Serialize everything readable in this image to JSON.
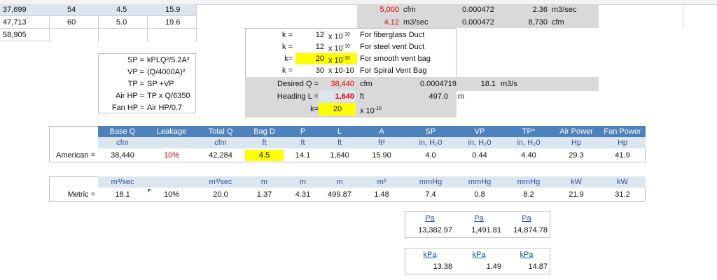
{
  "sheet": {
    "top_left_rows": [
      {
        "a": "37,699",
        "b": "54",
        "c": "4.5",
        "d": "15.9"
      },
      {
        "a": "47,713",
        "b": "60",
        "c": "5.0",
        "d": "19.6"
      },
      {
        "a": "58,905",
        "b": "",
        "c": "",
        "d": ""
      }
    ],
    "conversions": [
      {
        "v1": "5,000",
        "u1": "cfm",
        "f": "0.000472",
        "v2": "2.36",
        "u2": "m3/sec"
      },
      {
        "v1": "4.12",
        "u1": "m3/sec",
        "f": "0.000472",
        "v2": "8,730",
        "u2": "cfm"
      }
    ],
    "k_rows": [
      {
        "label": "k =",
        "value": "12",
        "mult": "x 10",
        "exp": "-10",
        "desc": "For fiberglass Duct"
      },
      {
        "label": "k =",
        "value": "12",
        "mult": "x 10",
        "exp": "-10",
        "desc": "For steel vent Duct"
      },
      {
        "label": "k=",
        "value": "20",
        "mult": "x 10",
        "exp": "-10",
        "desc": "For smooth vent bag"
      },
      {
        "label": "k =",
        "value": "30",
        "mult": "x 10-10",
        "exp": "",
        "desc": "For Spiral Vent Bag"
      }
    ],
    "desired_q": {
      "label": "Desired Q =",
      "value": "38,440",
      "unit": "cfm",
      "factor": "0.0004719",
      "metric": "18.1",
      "metric_unit": "m3/s"
    },
    "heading": {
      "label": "Heading L =",
      "value": "1,640",
      "unit": "ft",
      "metric": "497.0",
      "metric_unit": "m"
    },
    "k_selected": {
      "label": "k=",
      "value": "20",
      "mult": "x 10",
      "exp": "-10"
    },
    "formulas": [
      {
        "lhs": "SP =",
        "rhs": "kPLQ²/5.2A³"
      },
      {
        "lhs": "VP =",
        "rhs": "(Q/4000A)²"
      },
      {
        "lhs": "TP =",
        "rhs": "SP +VP"
      },
      {
        "lhs": "Air HP =",
        "rhs": "TP x Q/6350"
      },
      {
        "lhs": "Fan HP ≈",
        "rhs": "Air HP/0.7"
      }
    ],
    "results": {
      "headers": [
        "Base Q",
        "Leakage",
        "Total Q",
        "Bag D",
        "P",
        "L",
        "A",
        "SP",
        "VP",
        "TP*",
        "Air Power",
        "Fan Power"
      ],
      "units_us": [
        "cfm",
        "",
        "cfm",
        "ft",
        "ft",
        "ft",
        "ft²",
        "in, H₂0",
        "in, H₂0",
        "in, H₂0",
        "Hp",
        "Hp"
      ],
      "american_label": "American =",
      "american": [
        "38,440",
        "10%",
        "42,284",
        "4.5",
        "14.1",
        "1,640",
        "15.90",
        "4.0",
        "0.44",
        "4.40",
        "29.3",
        "41.9"
      ],
      "units_metric": [
        "m³/sec",
        "",
        "m³/sec",
        "m",
        "m",
        "m",
        "m²",
        "mmHg",
        "mmHg",
        "mmHg",
        "kW",
        "kW"
      ],
      "metric_label": "Metric =",
      "metric": [
        "18.1",
        "10%",
        "20.0",
        "1.37",
        "4.31",
        "499.87",
        "1.48",
        "7.4",
        "0.8",
        "8.2",
        "21.9",
        "31.2"
      ]
    },
    "pa": {
      "headers": [
        "Pa",
        "Pa",
        "Pa"
      ],
      "values": [
        "13,382.97",
        "1,491.81",
        "14,874.78"
      ]
    },
    "kpa": {
      "headers": [
        "kPa",
        "kPa",
        "kPa"
      ],
      "values": [
        "13.38",
        "1.49",
        "14.87"
      ]
    }
  }
}
